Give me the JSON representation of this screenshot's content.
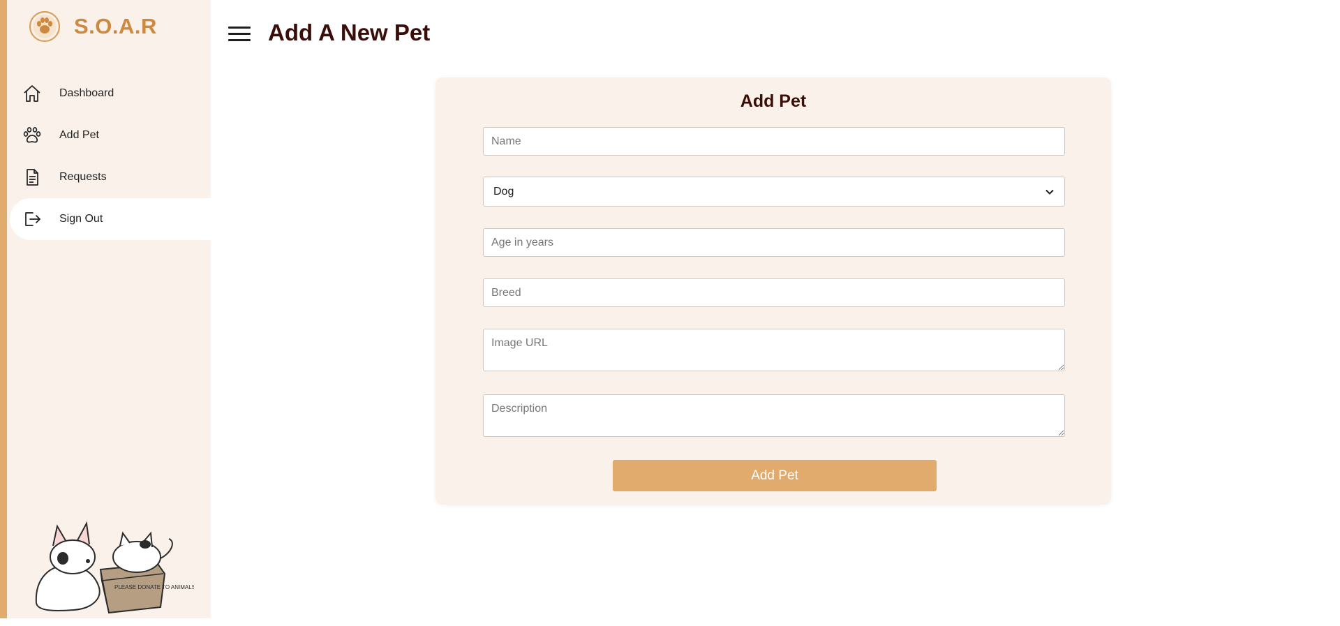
{
  "brand": {
    "name": "S.O.A.R",
    "logo_icon": "paw-heart-logo-icon",
    "accent": "#cd893f"
  },
  "sidebar": {
    "items": [
      {
        "label": "Dashboard",
        "icon": "home-icon"
      },
      {
        "label": "Add Pet",
        "icon": "paw-icon"
      },
      {
        "label": "Requests",
        "icon": "document-icon"
      },
      {
        "label": "Sign Out",
        "icon": "sign-out-icon",
        "active": true
      }
    ],
    "illustration_text": "PLEASE DONATE TO ANIMALS"
  },
  "header": {
    "title": "Add A New Pet",
    "menu_icon": "hamburger-menu-icon"
  },
  "form": {
    "title": "Add Pet",
    "name_placeholder": "Name",
    "type_value": "Dog",
    "age_placeholder": "Age in years",
    "breed_placeholder": "Breed",
    "image_url_placeholder": "Image URL",
    "description_placeholder": "Description",
    "submit_label": "Add Pet"
  },
  "colors": {
    "sidebar_bg": "#f9f1ea",
    "sidebar_border": "#e0ab6d",
    "title_color": "#3b0d09",
    "button_bg": "#e0ab6d"
  }
}
